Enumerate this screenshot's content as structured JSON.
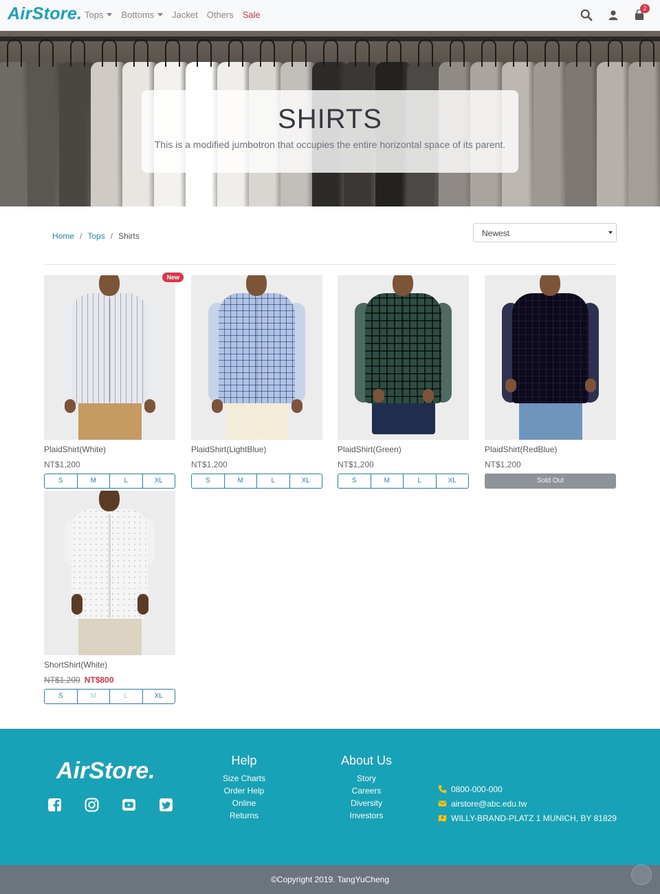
{
  "navbar": {
    "brand": "AirStore.",
    "links": [
      "Tops",
      "Bottoms",
      "Jacket",
      "Others",
      "Sale"
    ],
    "cart_count": "2",
    "icons": [
      "search-icon",
      "user-icon",
      "shopping-bag-icon"
    ]
  },
  "hero": {
    "title": "SHIRTS",
    "subtitle": "This is a modified jumbotron that occupies the entire horizontal space of its parent."
  },
  "breadcrumb": {
    "items": [
      "Home",
      "Tops",
      "Shirts"
    ]
  },
  "sort": {
    "selected": "Newest"
  },
  "products": [
    {
      "name": "PlaidShirt(White)",
      "price": "NT$1,200",
      "badge": "New",
      "sizes": [
        "S",
        "M",
        "L",
        "XL"
      ]
    },
    {
      "name": "PlaidShirt(LightBlue)",
      "price": "NT$1,200",
      "sizes": [
        "S",
        "M",
        "L",
        "XL"
      ]
    },
    {
      "name": "PlaidShirt(Green)",
      "price": "NT$1,200",
      "sizes": [
        "S",
        "M",
        "L",
        "XL"
      ]
    },
    {
      "name": "PlaidShirt(RedBlue)",
      "price": "NT$1,200",
      "status": "Sold Out"
    },
    {
      "name": "ShortShirt(White)",
      "original_price": "NT$1,200",
      "sale_price": "NT$800",
      "sizes": [
        "S",
        "M",
        "L",
        "XL"
      ]
    }
  ],
  "footer": {
    "brand": "AirStore.",
    "social": [
      "facebook-icon",
      "instagram-icon",
      "youtube-icon",
      "twitter-icon"
    ],
    "help": {
      "title": "Help",
      "links": [
        "Size Charts",
        "Order Help",
        "Online Returns"
      ]
    },
    "about": {
      "title": "About Us",
      "links": [
        "Story",
        "Careers",
        "Diversity",
        "Investors"
      ]
    },
    "contact": {
      "phone": "0800-000-000",
      "email": "airstore@abc.edu.tw",
      "address": "WILLY-BRAND-PLATZ 1 MUNICH, BY 81829"
    },
    "copyright": "©Copyright 2019. TangYuCheng"
  },
  "colors": {
    "accent": "#17a2b8",
    "sale": "#dc3545",
    "link": "#1b8fb8",
    "footer_bottom": "#6c757d"
  }
}
